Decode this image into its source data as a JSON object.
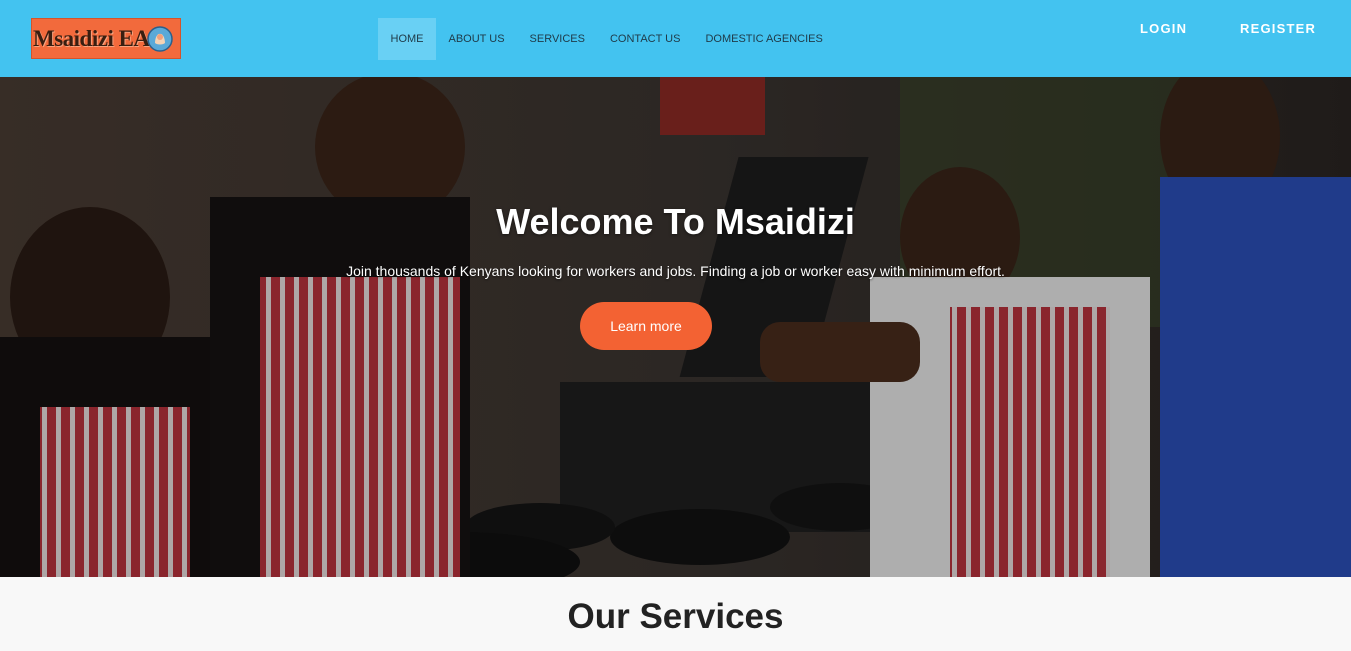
{
  "header": {
    "logo_text": "Msaidizi EA",
    "nav": [
      {
        "label": "HOME",
        "active": true
      },
      {
        "label": "ABOUT US",
        "active": false
      },
      {
        "label": "SERVICES",
        "active": false
      },
      {
        "label": "CONTACT US",
        "active": false
      },
      {
        "label": "DOMESTIC AGENCIES",
        "active": false
      }
    ],
    "login_label": "LOGIN",
    "register_label": "REGISTER"
  },
  "hero": {
    "title": "Welcome To Msaidizi",
    "subtitle": "Join thousands of Kenyans looking for workers and jobs. Finding a job or worker easy with minimum effort.",
    "button_label": "Learn more"
  },
  "services": {
    "title": "Our Services"
  },
  "colors": {
    "header_bg": "#43c3f0",
    "nav_active_bg": "#69d0f4",
    "accent": "#f36233",
    "logo_bg": "#f26a3c"
  },
  "icons": {
    "logo_mark": "baby-hands-icon"
  }
}
